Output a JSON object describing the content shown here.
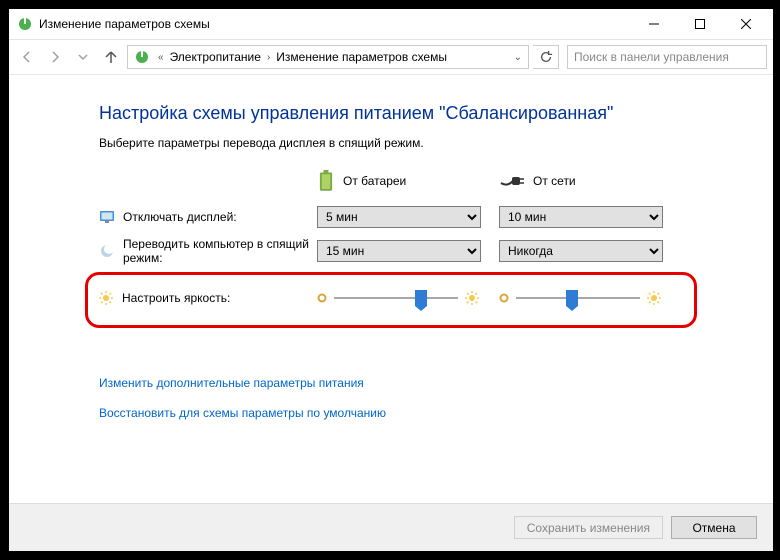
{
  "window": {
    "title": "Изменение параметров схемы"
  },
  "breadcrumb": {
    "items": [
      "Электропитание",
      "Изменение параметров схемы"
    ]
  },
  "search": {
    "placeholder": "Поиск в панели управления"
  },
  "page": {
    "heading": "Настройка схемы управления питанием \"Сбалансированная\"",
    "subtitle": "Выберите параметры перевода дисплея в спящий режим."
  },
  "columns": {
    "battery": "От батареи",
    "plugged": "От сети"
  },
  "rows": {
    "display_off": {
      "label": "Отключать дисплей:",
      "battery_value": "5 мин",
      "plugged_value": "10 мин"
    },
    "sleep": {
      "label": "Переводить компьютер в спящий режим:",
      "battery_value": "15 мин",
      "plugged_value": "Никогда"
    },
    "brightness": {
      "label": "Настроить яркость:",
      "battery_percent": 65,
      "plugged_percent": 40
    }
  },
  "links": {
    "advanced": "Изменить дополнительные параметры питания",
    "restore": "Восстановить для схемы параметры по умолчанию"
  },
  "buttons": {
    "save": "Сохранить изменения",
    "cancel": "Отмена"
  }
}
